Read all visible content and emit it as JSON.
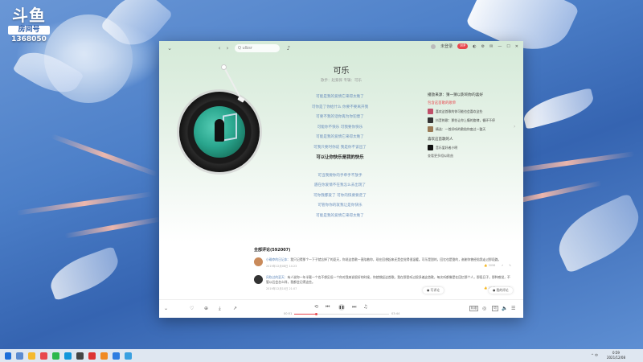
{
  "overlay": {
    "logo": "斗鱼",
    "room_label": "房间号",
    "room_number": "1368050"
  },
  "window": {
    "search_placeholder": "Q  ulbsr",
    "login_label": "未登录",
    "vip_badge": "VIP",
    "min_icon": "minimize-icon",
    "max_icon": "maximize-icon",
    "close_icon": "close-icon"
  },
  "song": {
    "title": "可乐",
    "meta": "歌手：赵紫骅    专辑：可乐"
  },
  "lyrics": [
    {
      "text": "可能是我的爱情它来得太晚了",
      "active": false
    },
    {
      "text": "可你是了你给什么 你要不要离开我",
      "active": false
    },
    {
      "text": "可要不我的话你再为你犯傻了",
      "active": false
    },
    {
      "text": "可能你不快乐 可我要你快乐",
      "active": false
    },
    {
      "text": "可能是我的爱情它来得太晚了",
      "active": false
    },
    {
      "text": "可我只要时你说 我是你不该出了",
      "active": false
    },
    {
      "text": "可以让你快乐是我的快乐",
      "active": true
    },
    {
      "text": "",
      "active": false
    },
    {
      "text": "可当我要你的手牵手不放手",
      "active": false
    },
    {
      "text": "遇在你爱情不在我怎么去出现了",
      "active": false
    },
    {
      "text": "可你我都爱了 可你的快要要走了",
      "active": false
    },
    {
      "text": "可管你你的就我让是你快乐",
      "active": false
    },
    {
      "text": "可能是我的爱情它来得太晚了",
      "active": false
    }
  ],
  "right_panel": {
    "title": "播放来源：猜一猜以影响你的喜好",
    "subtitle": "包含这首歌的歌单",
    "playlists": [
      {
        "name": "喜欢这首歌的你可能也会喜欢这些",
        "color": "#c0506a"
      },
      {
        "name": "抖音热歌：那些让你上瘾的旋律，循环不停",
        "color": "#333333"
      },
      {
        "name": "精选：一首好听的歌陪你度过一整天",
        "color": "#9a7a55"
      }
    ],
    "similar_title": "喜欢这首歌的人",
    "similar": [
      {
        "name": "音乐爱好者小明",
        "color": "#111111"
      }
    ],
    "more": "查看更多相似歌曲"
  },
  "comments": {
    "header": "全部评论(592007)",
    "items": [
      {
        "user": "小确幸的日记本：",
        "text": "我只记得那个一下子就忘掉了的夏天，你说这首歌一直陪着你，现在回想起来还是会觉得很温暖。可乐是甜的，回忆也是甜的，谢谢你曾经陪我走过那段路。",
        "time": "2019年12月08日 14:23",
        "likes": "3098",
        "avatar": "#c98a5a"
      },
      {
        "user": "风吹过的夏天：",
        "text": "有人说你一年半载一个也不想见但一个你对我来说很好的时候，你就想起这首歌。我在那里听过很多遍这首歌，每次听都像是在回忆那个人，那段日子，那种感觉，不管以后会怎么样，我都会记得这些。",
        "time": "2019年12月10日 21:07",
        "likes": "2846",
        "avatar": "#333333"
      }
    ],
    "float_left": "● 写评论",
    "float_right": "● 我的评论"
  },
  "player": {
    "time_current": "00:51",
    "time_total": "03:44",
    "progress": 0.23,
    "badge_quality": "标准",
    "badge_lyric": "词"
  },
  "taskbar": {
    "clock_time": "0:59",
    "clock_date": "2021/12/08",
    "tray": "^ 中"
  }
}
